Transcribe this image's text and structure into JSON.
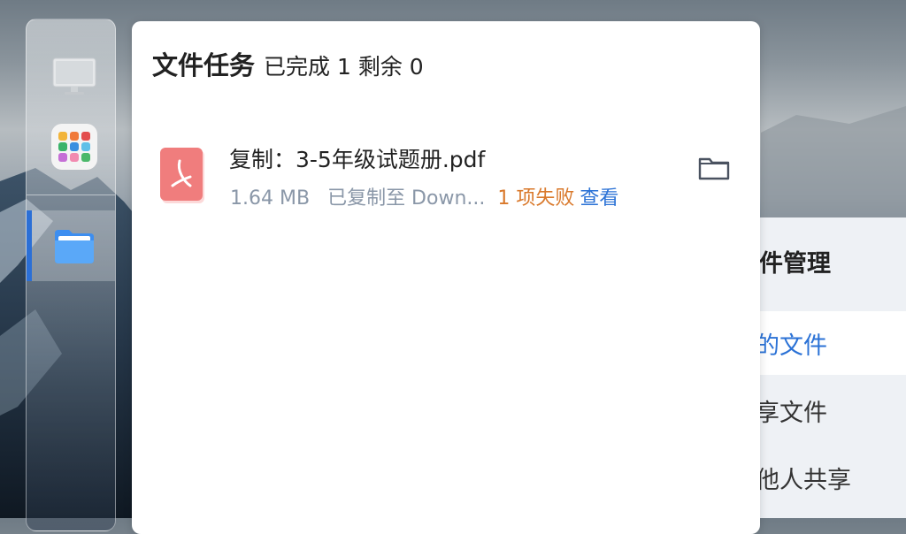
{
  "background_window": {
    "title": "件管理",
    "items": [
      {
        "label": "的文件",
        "active": true
      },
      {
        "label": "享文件",
        "active": false
      },
      {
        "label": "他人共享",
        "active": false
      }
    ]
  },
  "dock": {
    "items": [
      {
        "icon": "monitor-icon"
      },
      {
        "icon": "app-grid-icon"
      },
      {
        "icon": "folder-icon",
        "active": true
      }
    ]
  },
  "panel": {
    "title": "文件任务",
    "summary": "已完成 1 剩余 0",
    "tasks": [
      {
        "icon": "pdf-file-icon",
        "name": "复制：3-5年级试题册.pdf",
        "size": "1.64 MB",
        "status": "已复制至 Down...",
        "fail": "1 项失败",
        "view_label": "查看"
      }
    ]
  },
  "colors": {
    "accent": "#2b72d6",
    "fail": "#d9782a",
    "muted": "#8a97a8",
    "pdf": "#f07d7d"
  }
}
